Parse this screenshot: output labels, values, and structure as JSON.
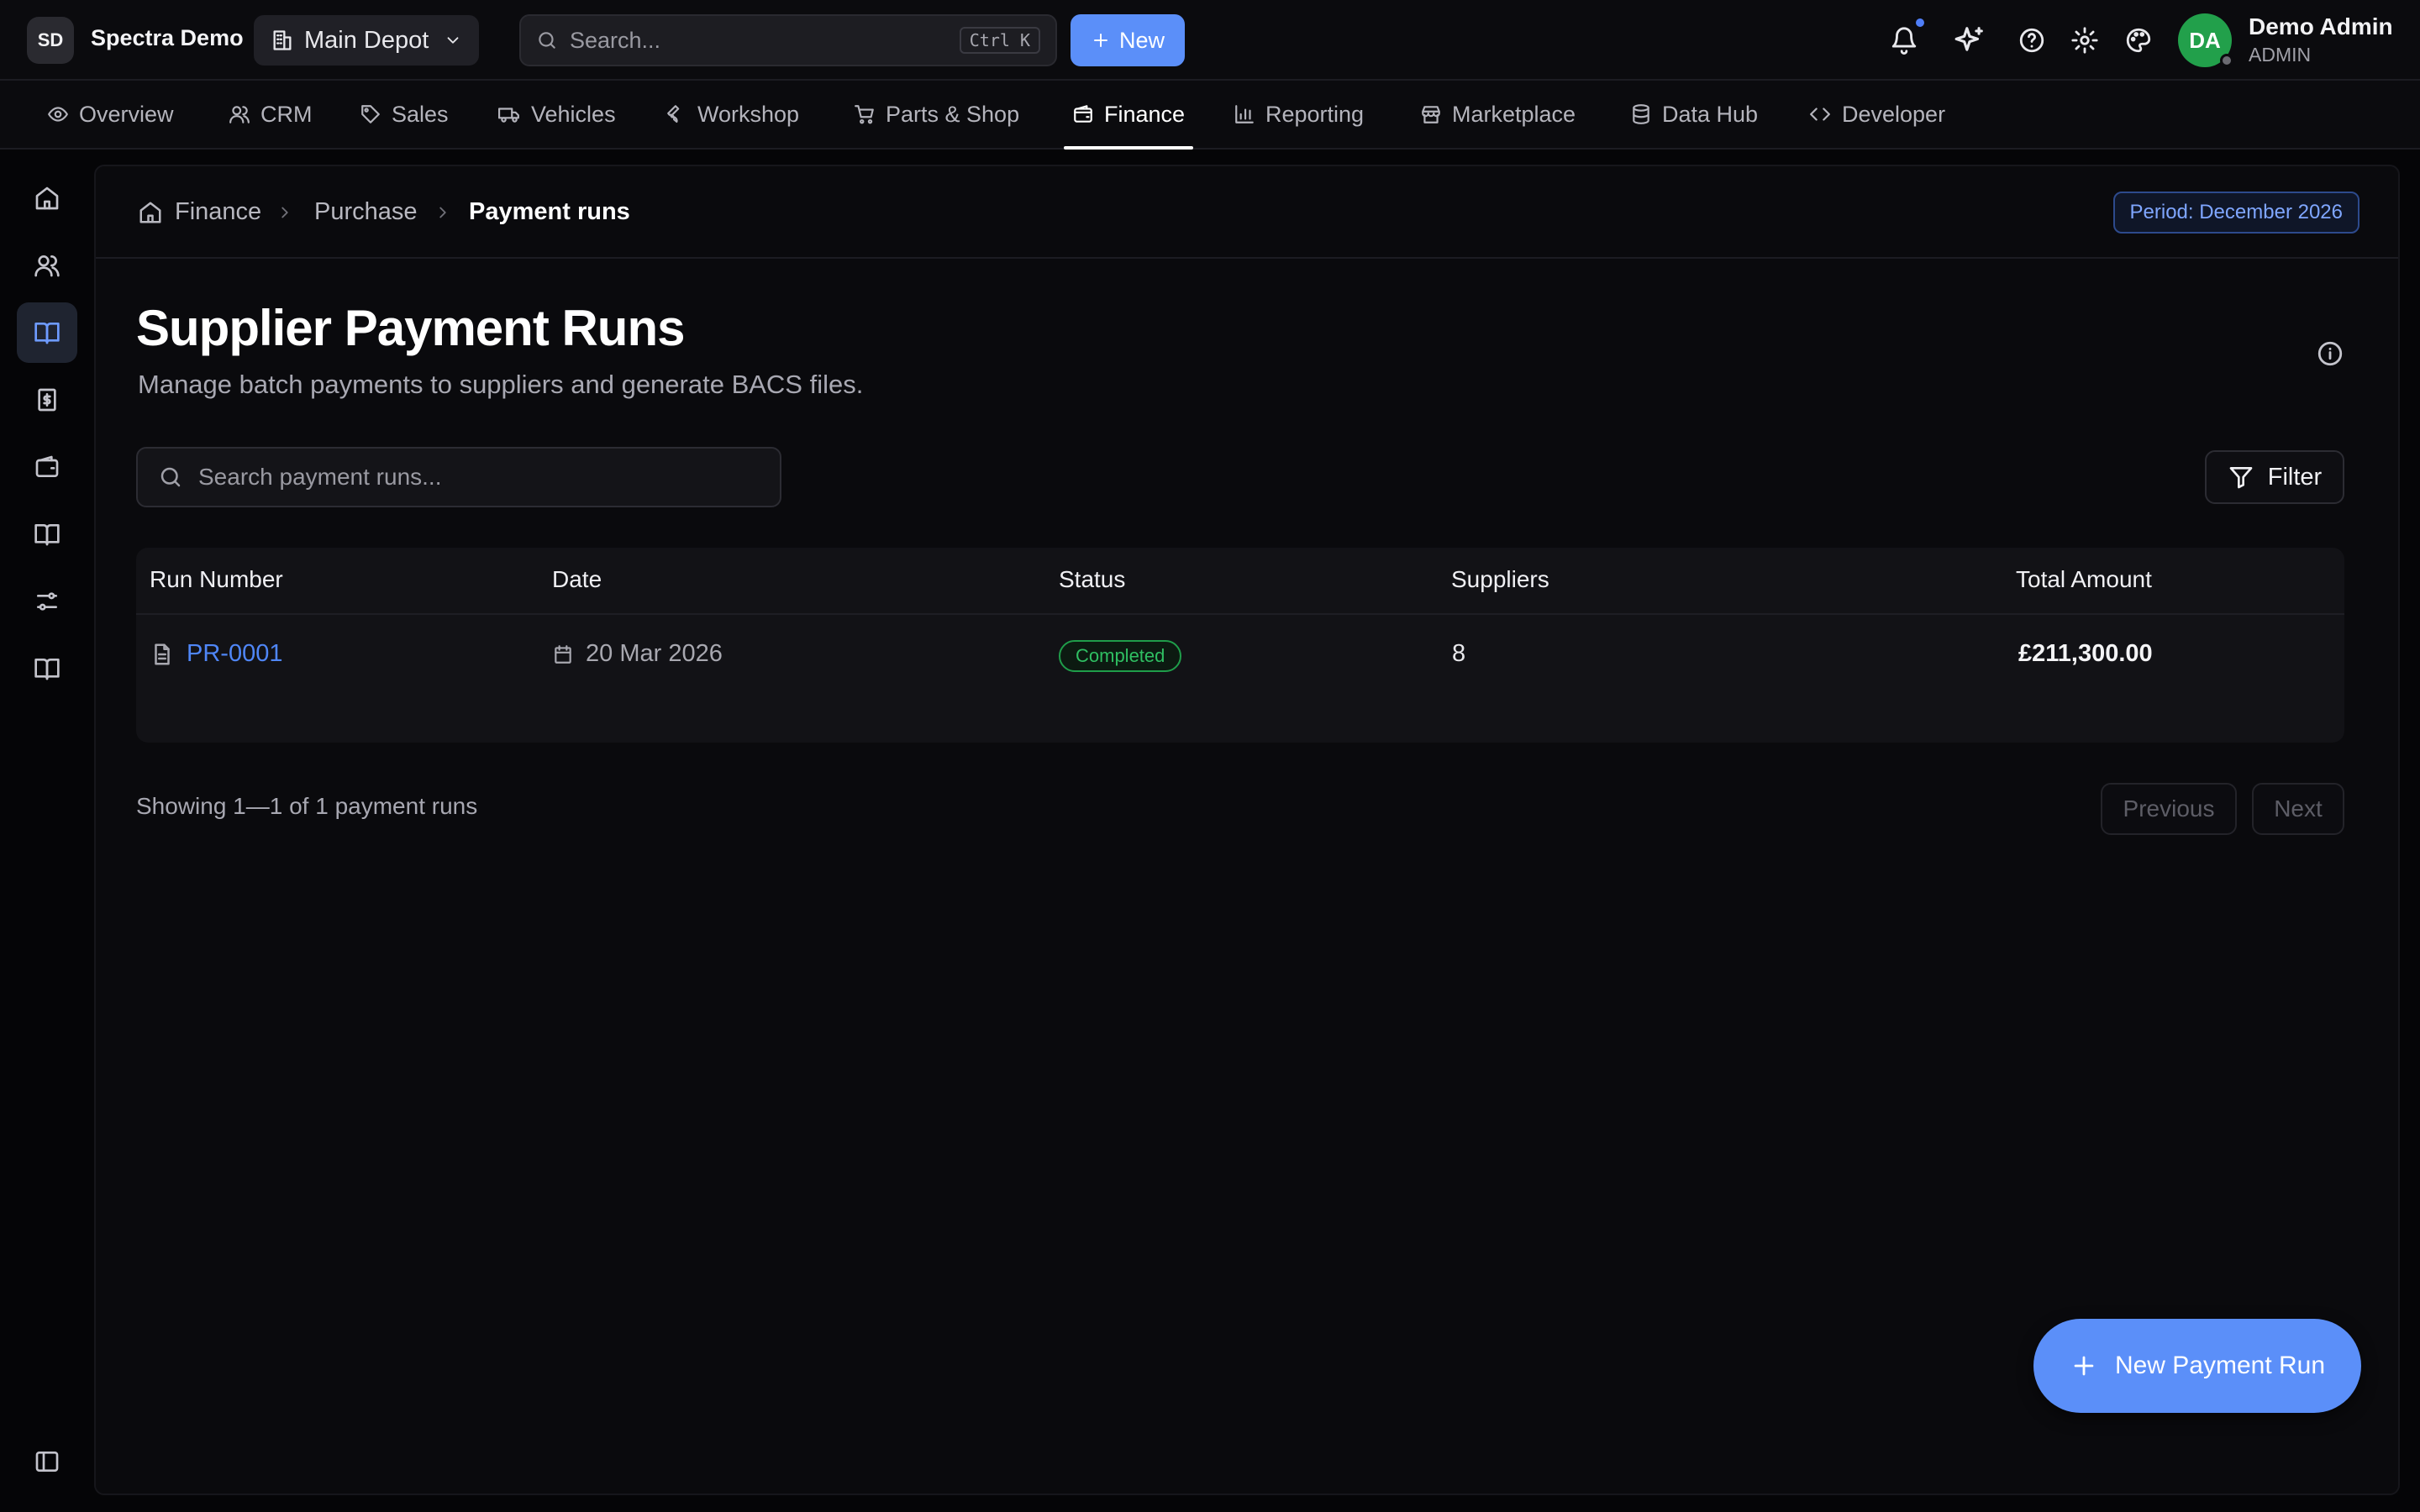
{
  "header": {
    "brand_initials": "SD",
    "brand_name": "Spectra Demo",
    "depot": "Main Depot",
    "search_placeholder": "Search...",
    "shortcut": "Ctrl K",
    "new_label": "New",
    "user": {
      "initials": "DA",
      "name": "Demo Admin",
      "role": "ADMIN"
    }
  },
  "nav": {
    "tabs": [
      {
        "label": "Overview",
        "icon": "eye-icon"
      },
      {
        "label": "CRM",
        "icon": "users-icon"
      },
      {
        "label": "Sales",
        "icon": "tag-icon"
      },
      {
        "label": "Vehicles",
        "icon": "truck-icon"
      },
      {
        "label": "Workshop",
        "icon": "wrench-icon"
      },
      {
        "label": "Parts & Shop",
        "icon": "cart-icon"
      },
      {
        "label": "Finance",
        "icon": "wallet-icon",
        "active": true
      },
      {
        "label": "Reporting",
        "icon": "bar-chart-icon"
      },
      {
        "label": "Marketplace",
        "icon": "store-icon"
      },
      {
        "label": "Data Hub",
        "icon": "database-icon"
      },
      {
        "label": "Developer",
        "icon": "code-icon"
      }
    ]
  },
  "breadcrumb": {
    "items": [
      "Finance",
      "Purchase",
      "Payment runs"
    ],
    "period": "Period: December 2026"
  },
  "page": {
    "title": "Supplier Payment Runs",
    "subtitle": "Manage batch payments to suppliers and generate BACS files.",
    "search_placeholder": "Search payment runs...",
    "filter_label": "Filter"
  },
  "table": {
    "columns": [
      "Run Number",
      "Date",
      "Status",
      "Suppliers",
      "Total Amount"
    ],
    "rows": [
      {
        "run_number": "PR-0001",
        "date": "20 Mar 2026",
        "status": "Completed",
        "suppliers": "8",
        "total": "£211,300.00"
      }
    ]
  },
  "pagination": {
    "summary": "Showing 1—1 of 1 payment runs",
    "previous": "Previous",
    "next": "Next"
  },
  "fab_label": "New Payment Run",
  "colors": {
    "accent": "#5b8ff9",
    "link": "#4f86f7",
    "success": "#2fbf62",
    "avatar": "#22a04b"
  }
}
